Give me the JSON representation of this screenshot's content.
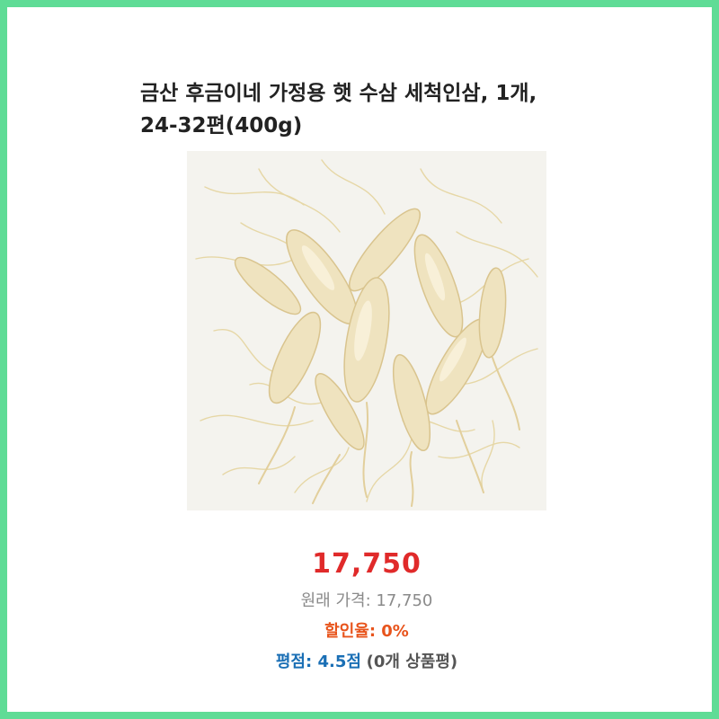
{
  "page": {
    "frame_color": "#5fdc96"
  },
  "product": {
    "title_line1": "금산 후금이네 가정용 햇 수삼 세척인삼, 1개,",
    "title_line2": "24-32편(400g)",
    "image_alt": "washed fresh ginseng roots"
  },
  "pricing": {
    "sale_price": "17,750",
    "original_price_text": "원래 가격: 17,750",
    "discount_text": "할인율: 0%",
    "rating_text": "평점: 4.5점",
    "review_text": "(0개 상품평)",
    "colors": {
      "sale_price": "#e02a2a",
      "discount": "#e8541c",
      "rating": "#1a6fb5"
    }
  }
}
